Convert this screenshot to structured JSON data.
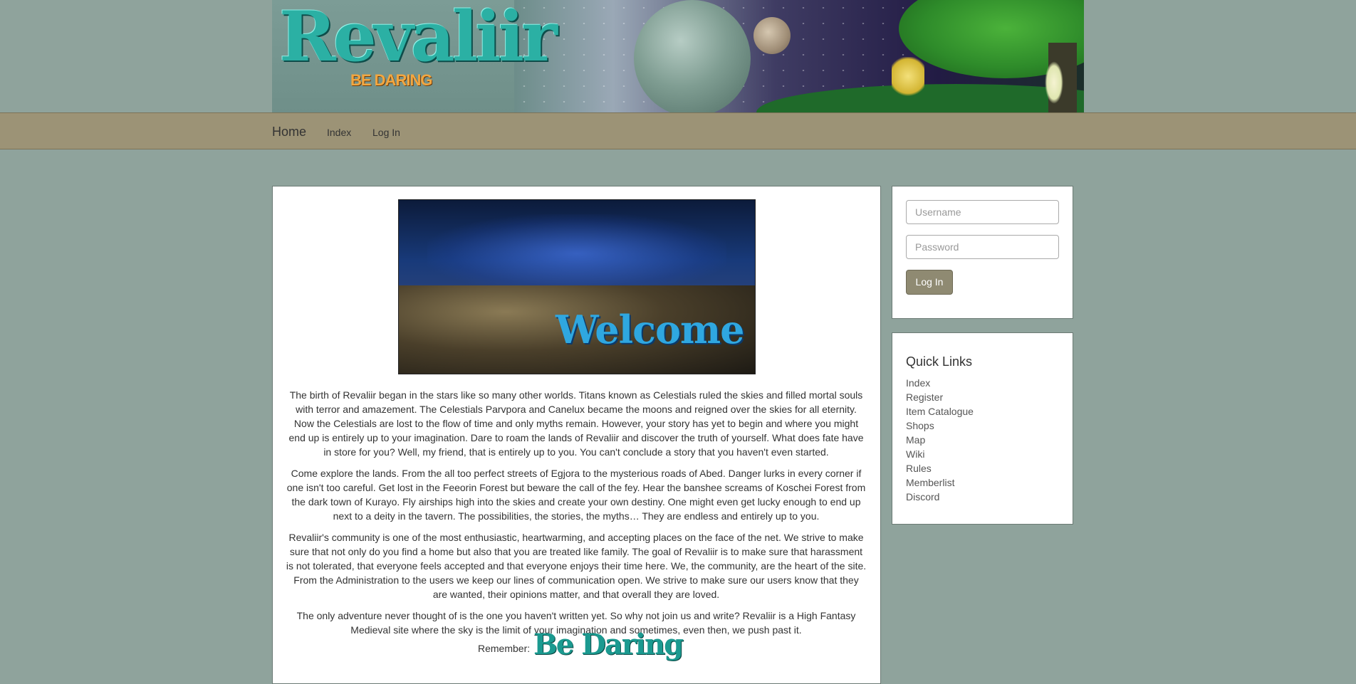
{
  "banner": {
    "logo_text": "Revaliir",
    "tagline": "BE DARING"
  },
  "nav": {
    "brand": "Home",
    "links": [
      "Index",
      "Log In"
    ]
  },
  "main": {
    "welcome_word": "Welcome",
    "paragraphs": [
      "The birth of Revaliir began in the stars like so many other worlds. Titans known as Celestials ruled the skies and filled mortal souls with terror and amazement. The Celestials Parvpora and Canelux became the moons and reigned over the skies for all eternity. Now the Celestials are lost to the flow of time and only myths remain. However, your story has yet to begin and where you might end up is entirely up to your imagination. Dare to roam the lands of Revaliir and discover the truth of yourself. What does fate have in store for you? Well, my friend, that is entirely up to you. You can't conclude a story that you haven't even started.",
      "Come explore the lands. From the all too perfect streets of Egjora to the mysterious roads of Abed. Danger lurks in every corner if one isn't too careful. Get lost in the Feeorin Forest but beware the call of the fey. Hear the banshee screams of Koschei Forest from the dark town of Kurayo. Fly airships high into the skies and create your own destiny. One might even get lucky enough to end up next to a deity in the tavern. The possibilities, the stories, the myths… They are endless and entirely up to you.",
      "Revaliir's community is one of the most enthusiastic, heartwarming, and accepting places on the face of the net. We strive to make sure that not only do you find a home but also that you are treated like family. The goal of Revaliir is to make sure that harassment is not tolerated, that everyone feels accepted and that everyone enjoys their time here. We, the community, are the heart of the site. From the Administration to the users we keep our lines of communication open. We strive to make sure our users know that they are wanted, their opinions matter, and that overall they are loved.",
      "The only adventure never thought of is the one you haven't written yet. So why not join us and write? Revaliir is a High Fantasy Medieval site where the sky is the limit of your imagination and sometimes, even then, we push past it."
    ],
    "remember_label": "Remember:",
    "remember_art": "Be Daring"
  },
  "login": {
    "username_placeholder": "Username",
    "password_placeholder": "Password",
    "button_label": "Log In"
  },
  "quick_links": {
    "title": "Quick Links",
    "items": [
      "Index",
      "Register",
      "Item Catalogue",
      "Shops",
      "Map",
      "Wiki",
      "Rules",
      "Memberlist",
      "Discord"
    ]
  }
}
